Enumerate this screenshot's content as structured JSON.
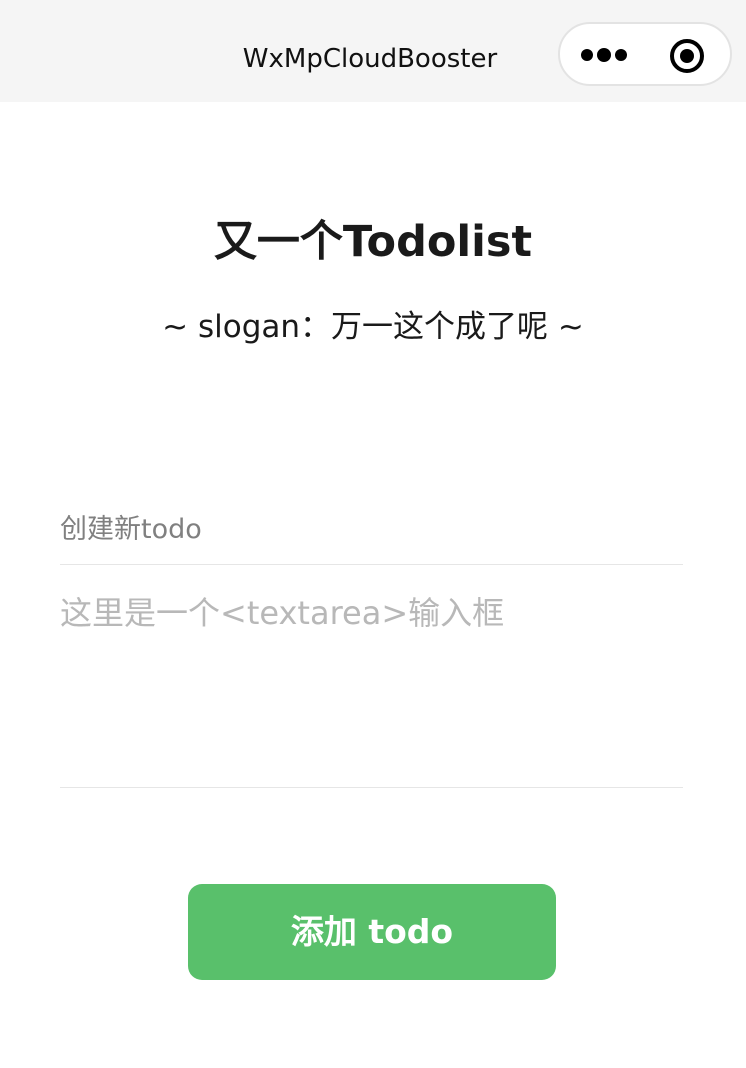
{
  "nav_bar": {
    "title": "WxMpCloudBooster",
    "background": "#f5f5f5",
    "capsule": {
      "more_icon": "more-dots-icon",
      "close_icon": "target-close-icon"
    }
  },
  "header": {
    "title": "又一个Todolist",
    "slogan": "~ slogan：万一这个成了呢 ~"
  },
  "form": {
    "label": "创建新todo",
    "textarea_value": "",
    "textarea_placeholder": "这里是一个<textarea>输入框",
    "submit_label": "添加 todo"
  },
  "colors": {
    "accent": "#59c06b",
    "label": "#808080",
    "placeholder": "#b8b8b8",
    "divider": "#e6e6e6"
  }
}
